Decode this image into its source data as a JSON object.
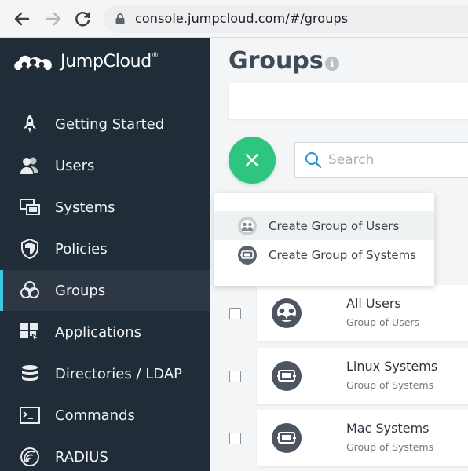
{
  "browser": {
    "url": "console.jumpcloud.com/#/groups"
  },
  "brand": {
    "name": "JumpCloud",
    "mark": "®"
  },
  "sidebar": {
    "items": [
      {
        "label": "Getting Started",
        "icon": "rocket-icon"
      },
      {
        "label": "Users",
        "icon": "users-icon"
      },
      {
        "label": "Systems",
        "icon": "systems-icon"
      },
      {
        "label": "Policies",
        "icon": "shield-icon"
      },
      {
        "label": "Groups",
        "icon": "groups-icon",
        "active": true
      },
      {
        "label": "Applications",
        "icon": "applications-icon"
      },
      {
        "label": "Directories / LDAP",
        "icon": "database-icon"
      },
      {
        "label": "Commands",
        "icon": "terminal-icon"
      },
      {
        "label": "RADIUS",
        "icon": "radius-icon"
      }
    ]
  },
  "main": {
    "title": "Groups",
    "info_glyph": "i",
    "search": {
      "placeholder": "Search"
    },
    "rows": [
      {
        "name": "All Users",
        "type": "Group of Users",
        "icon": "users-group-icon"
      },
      {
        "name": "Linux Systems",
        "type": "Group of Systems",
        "icon": "systems-group-icon"
      },
      {
        "name": "Mac Systems",
        "type": "Group of Systems",
        "icon": "systems-group-icon"
      }
    ]
  },
  "menu": {
    "items": [
      {
        "label": "Create Group of Users",
        "icon": "users-group-icon"
      },
      {
        "label": "Create Group of Systems",
        "icon": "systems-group-icon"
      }
    ]
  },
  "colors": {
    "sidebar_bg": "#202c38",
    "active_accent": "#3fc6e0",
    "fab_green": "#2ec57e",
    "search_icon_blue": "#2a8fd6"
  }
}
